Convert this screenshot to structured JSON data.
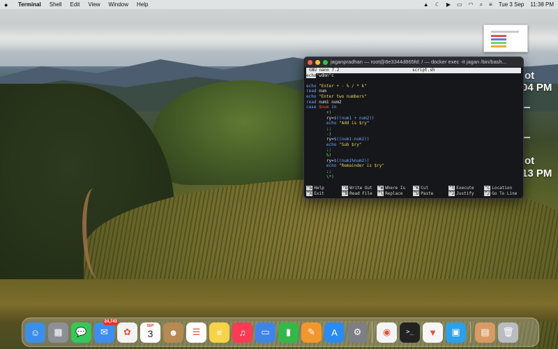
{
  "menubar": {
    "app": "Terminal",
    "menus": [
      "Shell",
      "Edit",
      "View",
      "Window",
      "Help"
    ],
    "date": "Tue 3 Sep",
    "time": "11:38 PM"
  },
  "widgets": {
    "clock1_a": "ot",
    "clock1_b": "04 PM",
    "clock2_a": "ot",
    "clock2_b": "13 PM"
  },
  "terminal": {
    "title": "jaganpradhan — root@8e3344d865fd: / — docker exec -it jagan /bin/bash...",
    "nano_version": "GNU nano 7.2",
    "filename": "script.sh",
    "lines": [
      {
        "parts": [
          {
            "t": "echo",
            "c": "kw",
            "cursor": true
          },
          {
            "t": "\"wdmn\"c",
            "c": "plain"
          }
        ]
      },
      {
        "parts": [
          {
            "t": "",
            "c": "plain"
          }
        ]
      },
      {
        "parts": [
          {
            "t": "echo ",
            "c": "kw"
          },
          {
            "t": "\"Enter + - % / * k\"",
            "c": "str"
          }
        ]
      },
      {
        "parts": [
          {
            "t": "read ",
            "c": "kw"
          },
          {
            "t": "num",
            "c": "plain"
          }
        ]
      },
      {
        "parts": [
          {
            "t": "echo ",
            "c": "kw"
          },
          {
            "t": "\"Enter two numbers\"",
            "c": "str"
          }
        ]
      },
      {
        "parts": [
          {
            "t": "read ",
            "c": "kw"
          },
          {
            "t": "num1 num2",
            "c": "plain"
          }
        ]
      },
      {
        "parts": [
          {
            "t": "case ",
            "c": "kw"
          },
          {
            "t": "$num",
            "c": "var"
          },
          {
            "t": " in",
            "c": "kw"
          }
        ]
      },
      {
        "parts": [
          {
            "t": "        +)",
            "c": "op"
          }
        ]
      },
      {
        "parts": [
          {
            "t": "        ry=",
            "c": "plain"
          },
          {
            "t": "$((num1 + num2))",
            "c": "kw"
          }
        ]
      },
      {
        "parts": [
          {
            "t": "        echo ",
            "c": "kw"
          },
          {
            "t": "\"Add is $ry\"",
            "c": "str"
          }
        ]
      },
      {
        "parts": [
          {
            "t": "        ;;",
            "c": "op"
          }
        ]
      },
      {
        "parts": [
          {
            "t": "        -)",
            "c": "op"
          }
        ]
      },
      {
        "parts": [
          {
            "t": "        ry=",
            "c": "plain"
          },
          {
            "t": "$((num1-num2))",
            "c": "kw"
          }
        ]
      },
      {
        "parts": [
          {
            "t": "        echo ",
            "c": "kw"
          },
          {
            "t": "\"Sub $ry\"",
            "c": "str"
          }
        ]
      },
      {
        "parts": [
          {
            "t": "        ;;",
            "c": "op"
          }
        ]
      },
      {
        "parts": [
          {
            "t": "        %)",
            "c": "op"
          }
        ]
      },
      {
        "parts": [
          {
            "t": "        ry=",
            "c": "plain"
          },
          {
            "t": "$((num1%num2))",
            "c": "kw"
          }
        ]
      },
      {
        "parts": [
          {
            "t": "        echo ",
            "c": "kw"
          },
          {
            "t": "\"Remainder is $ry\"",
            "c": "str"
          }
        ]
      },
      {
        "parts": [
          {
            "t": "        ;;",
            "c": "op"
          }
        ]
      },
      {
        "parts": [
          {
            "t": "        \\*)",
            "c": "op"
          }
        ]
      }
    ],
    "shortcuts_row1": [
      {
        "key": "^G",
        "label": "Help"
      },
      {
        "key": "^O",
        "label": "Write Out"
      },
      {
        "key": "^W",
        "label": "Where Is"
      },
      {
        "key": "^K",
        "label": "Cut"
      },
      {
        "key": "^T",
        "label": "Execute"
      },
      {
        "key": "^C",
        "label": "Location"
      }
    ],
    "shortcuts_row2": [
      {
        "key": "^X",
        "label": "Exit"
      },
      {
        "key": "^R",
        "label": "Read File"
      },
      {
        "key": "^\\",
        "label": "Replace"
      },
      {
        "key": "^U",
        "label": "Paste"
      },
      {
        "key": "^J",
        "label": "Justify"
      },
      {
        "key": "^/",
        "label": "Go To Line"
      }
    ]
  },
  "dock": {
    "mail_badge": "24,743",
    "calendar_month": "SEP",
    "calendar_day": "3",
    "apps": [
      {
        "name": "finder-app",
        "color": "#3b8fe8",
        "glyph": "☺"
      },
      {
        "name": "launchpad-app",
        "color": "#8d8f96",
        "glyph": "▦"
      },
      {
        "name": "messages-app",
        "color": "#34c759",
        "glyph": "💬"
      },
      {
        "name": "mail-app",
        "color": "#3d8ef0",
        "glyph": "✉"
      },
      {
        "name": "photos-app",
        "color": "#f3f3f3",
        "glyph": "✿"
      },
      {
        "name": "calendar-app",
        "color": "#ffffff",
        "glyph": ""
      },
      {
        "name": "contacts-app",
        "color": "#b58a53",
        "glyph": "☻"
      },
      {
        "name": "reminders-app",
        "color": "#ffffff",
        "glyph": "☰"
      },
      {
        "name": "notes-app",
        "color": "#f7d34a",
        "glyph": "≡"
      },
      {
        "name": "music-app",
        "color": "#fa3c55",
        "glyph": "♫"
      },
      {
        "name": "keynote-app",
        "color": "#3d86e6",
        "glyph": "▭"
      },
      {
        "name": "numbers-app",
        "color": "#33b84a",
        "glyph": "▮"
      },
      {
        "name": "pages-app",
        "color": "#f2972e",
        "glyph": "✎"
      },
      {
        "name": "app-store-app",
        "color": "#2a8bf2",
        "glyph": "A"
      },
      {
        "name": "system-settings-app",
        "color": "#7d7f85",
        "glyph": "⚙"
      },
      {
        "name": "chrome-app",
        "color": "#f4f4f4",
        "glyph": "◉"
      },
      {
        "name": "terminal-app",
        "color": "#222222",
        "glyph": ">_"
      },
      {
        "name": "brave-app",
        "color": "#f6f6f6",
        "glyph": "▼"
      },
      {
        "name": "docker-app",
        "color": "#2aa1e8",
        "glyph": "▣"
      },
      {
        "name": "downloads-folder",
        "color": "#d99a64",
        "glyph": "▤"
      },
      {
        "name": "trash-app",
        "color": "#b9bcc0",
        "glyph": "🗑"
      }
    ]
  }
}
